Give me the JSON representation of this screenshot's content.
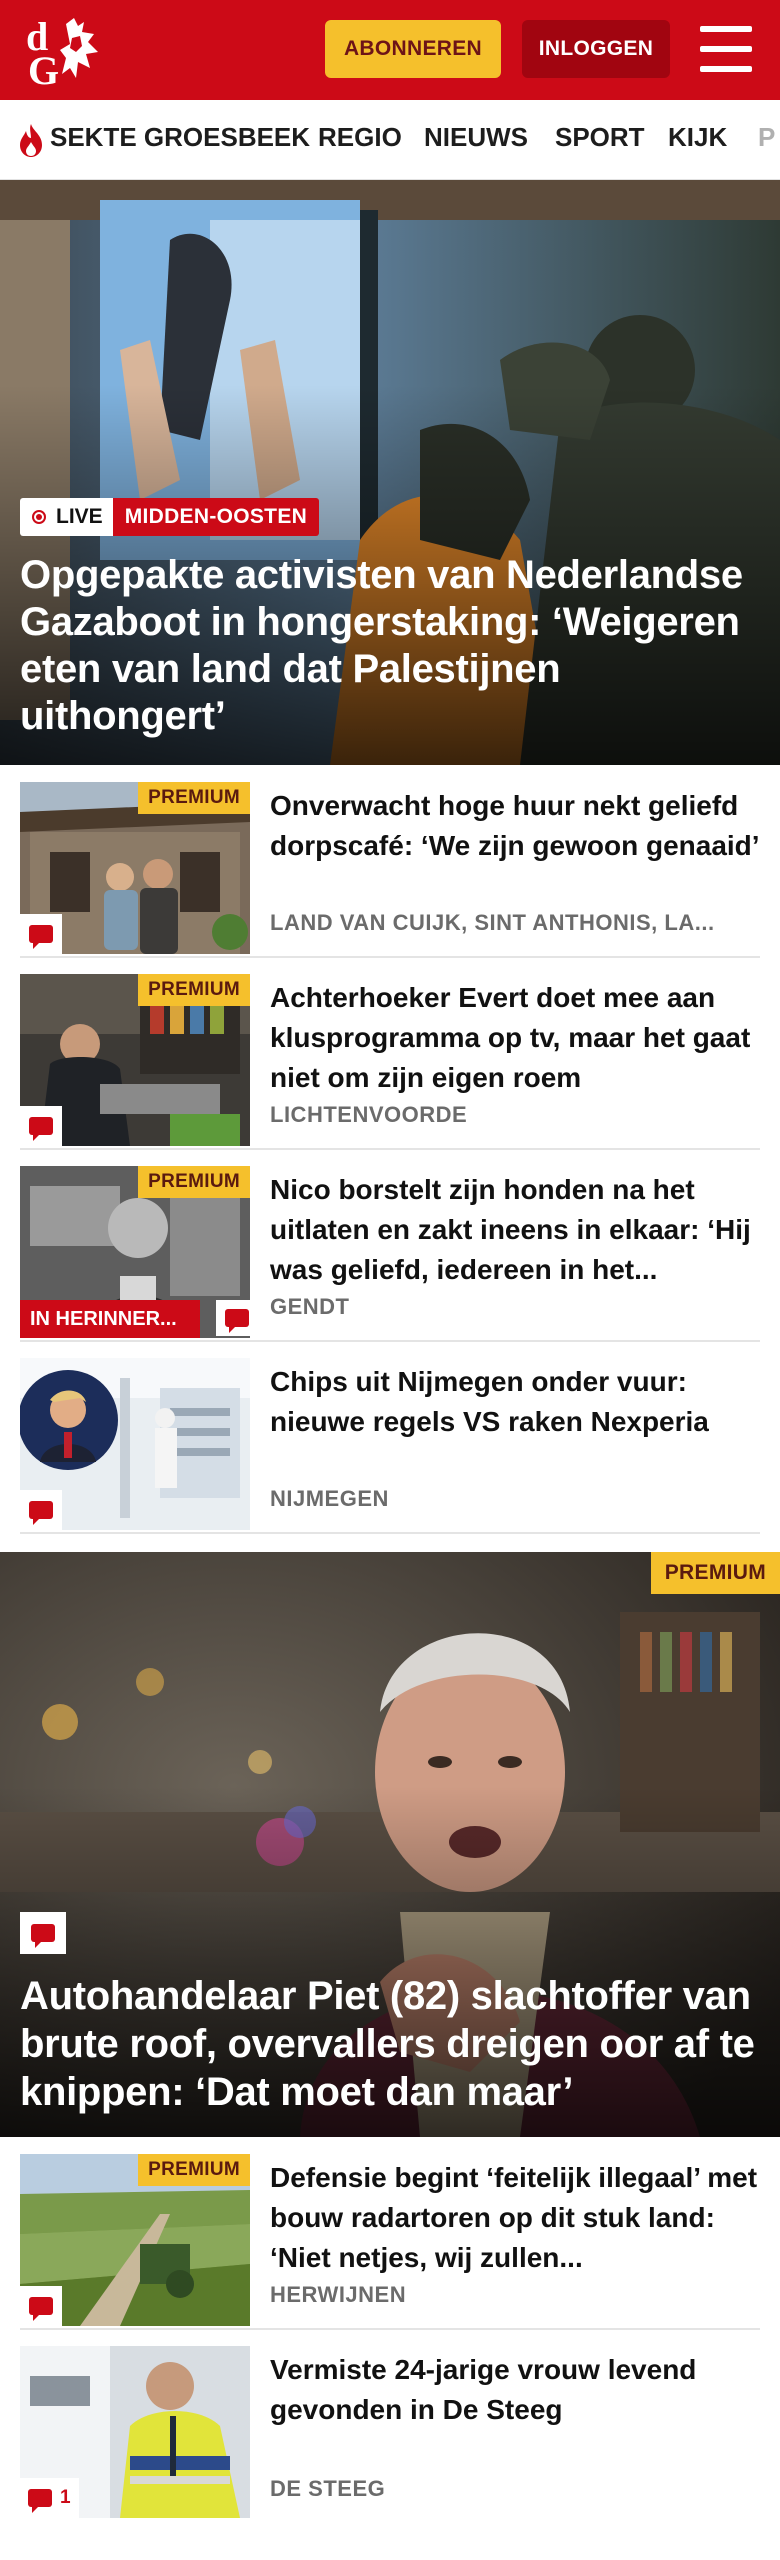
{
  "header": {
    "logo_text": "dG",
    "subscribe_label": "ABONNEREN",
    "login_label": "INLOGGEN",
    "brand_color": "#cc0a17"
  },
  "nav": {
    "items": [
      {
        "label": "SEKTE GROESBEEK",
        "icon": "flame-icon"
      },
      {
        "label": "REGIO"
      },
      {
        "label": "NIEUWS"
      },
      {
        "label": "SPORT"
      },
      {
        "label": "KIJK"
      },
      {
        "label": "P"
      }
    ]
  },
  "hero": {
    "live_label": "LIVE",
    "category": "MIDDEN-OOSTEN",
    "title": "Opgepakte activisten van Nederland­se Gazaboot in hongerstaking: ‘Weigeren eten van land dat Palestij­nen uithongert’"
  },
  "articles": [
    {
      "premium": "PREMIUM",
      "title": "Onverwacht hoge huur nekt geliefd dorpscafé: ‘We zijn gewoon genaaid’",
      "location": "LAND VAN CUIJK, SINT ANTHONIS, LA..."
    },
    {
      "premium": "PREMIUM",
      "title": "Achterhoeker Evert doet mee aan klusprogramma op tv, maar het gaat niet om zijn eigen roem",
      "location": "LICHTENVOORDE"
    },
    {
      "premium": "PREMIUM",
      "memoriam": "IN HERINNER...",
      "title": "Nico borstelt zijn honden na het uitlaten en zakt ineens in elkaar: ‘Hij was geliefd, iedereen in het...",
      "location": "GENDT"
    },
    {
      "title": "Chips uit Nijmegen onder vuur: nieuwe regels VS raken Nexperia",
      "location": "NIJMEGEN"
    }
  ],
  "feature": {
    "premium": "PREMIUM",
    "title": "Autohandelaar Piet (82) slachtoffer van brute roof, overvallers dreigen oor af te knippen: ‘Dat moet dan maar’"
  },
  "articles2": [
    {
      "premium": "PREMIUM",
      "title": "Defensie begint ‘feitelijk illegaal’ met bouw radartoren op dit stuk land: ‘Niet netjes, wij zullen...",
      "location": "HERWIJNEN"
    },
    {
      "title": "Vermiste 24-jarige vrouw levend gevonden in De Steeg",
      "location": "DE STEEG",
      "comment_count": "1"
    }
  ]
}
